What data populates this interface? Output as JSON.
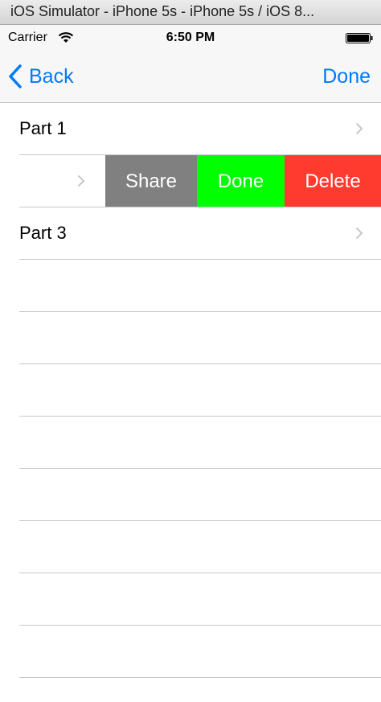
{
  "window": {
    "title": "iOS Simulator - iPhone 5s - iPhone 5s / iOS 8..."
  },
  "status_bar": {
    "carrier": "Carrier",
    "time": "6:50 PM"
  },
  "nav_bar": {
    "back_label": "Back",
    "done_label": "Done"
  },
  "rows": [
    {
      "label": "Part 1"
    },
    {
      "label": ""
    },
    {
      "label": "Part 3"
    }
  ],
  "swipe_actions": {
    "share": "Share",
    "done": "Done",
    "delete": "Delete",
    "colors": {
      "share": "#808080",
      "done": "#00ff00",
      "delete": "#ff3b30"
    }
  },
  "icons": [
    "back-chevron-icon",
    "disclosure-chevron-icon",
    "wifi-icon",
    "battery-icon"
  ]
}
